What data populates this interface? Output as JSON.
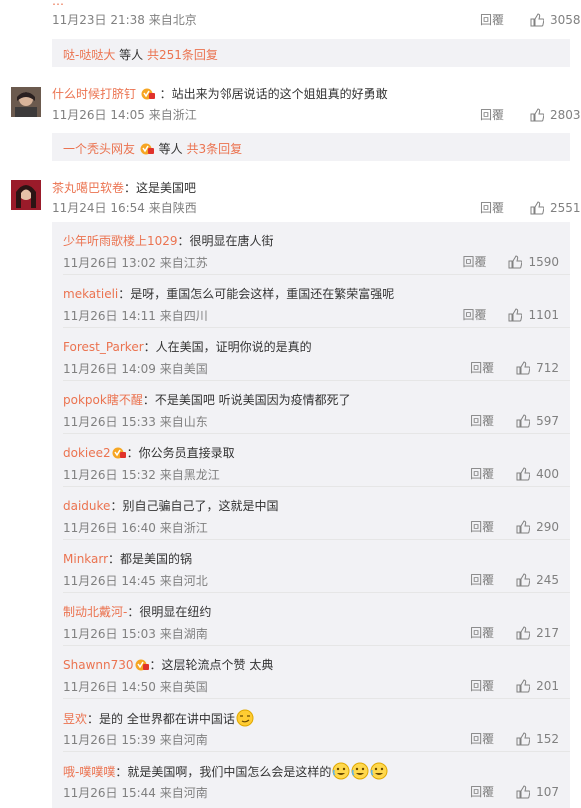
{
  "top": {
    "partial_text": "…",
    "meta": "11月23日 21:38 来自北京",
    "reply": "回覆",
    "likes": "3058",
    "sub_users": "哒-哒哒大",
    "sub_mid": " 等人",
    "sub_count": " 共251条回复"
  },
  "c1": {
    "user": "什么时候打脐钉",
    "text": "：站出来为邻居说话的这个姐姐真的好勇敢",
    "meta": "11月26日 14:05 来自浙江",
    "reply": "回覆",
    "likes": "2803",
    "sub_users": "一个秃头网友",
    "sub_mid": "等人",
    "sub_count": " 共3条回复"
  },
  "c2": {
    "user": "茶丸噶巴软卷",
    "text": "：这是美国吧",
    "meta": "11月24日 16:54 来自陕西",
    "reply": "回覆",
    "likes": "2551"
  },
  "replies": [
    {
      "user": "少年听雨歌楼上1029",
      "text": "：很明显在唐人街",
      "meta": "11月26日 13:02 来自江苏",
      "reply": "回覆",
      "likes": "1590"
    },
    {
      "user": "mekatieli",
      "text": "：是呀，重国怎么可能会这样，重国还在繁荣富强呢",
      "meta": "11月26日 14:11 来自四川",
      "reply": "回覆",
      "likes": "1101"
    },
    {
      "user": "Forest_Parker",
      "text": "：人在美国，证明你说的是真的",
      "meta": "11月26日 14:09 来自美国",
      "reply": "回覆",
      "likes": "712"
    },
    {
      "user": "pokpok瞎不醒",
      "text": "：不是美国吧 听说美国因为疫情都死了",
      "meta": "11月26日 15:33 来自山东",
      "reply": "回覆",
      "likes": "597"
    },
    {
      "user": "dokiee2",
      "text": "：你公务员直接录取",
      "meta": "11月26日 15:32 来自黑龙江",
      "reply": "回覆",
      "likes": "400"
    },
    {
      "user": "daiduke",
      "text": "：别自己骗自己了，这就是中国",
      "meta": "11月26日 16:40 来自浙江",
      "reply": "回覆",
      "likes": "290"
    },
    {
      "user": "Minkarr",
      "text": "：都是美国的锅",
      "meta": "11月26日 14:45 来自河北",
      "reply": "回覆",
      "likes": "245"
    },
    {
      "user": "制动北戴河-",
      "text": "：很明显在纽约",
      "meta": "11月26日 15:03 来自湖南",
      "reply": "回覆",
      "likes": "217"
    },
    {
      "user": "Shawnn730",
      "text": "：这层轮流点个赞 太典",
      "meta": "11月26日 14:50 来自英国",
      "reply": "回覆",
      "likes": "201"
    },
    {
      "user": "昱欢",
      "text": "：是的 全世界都在讲中国话",
      "meta": "11月26日 15:39 来自河南",
      "reply": "回覆",
      "likes": "152"
    },
    {
      "user": "哦-噗噗噗",
      "text": "：就是美国啊，我们中国怎么会是这样的",
      "meta": "11月26日 15:44 来自河南",
      "reply": "回覆",
      "likes": "107"
    }
  ],
  "colors": {
    "accent": "#eb7350",
    "meta": "#808080",
    "panel": "#f2f2f5"
  },
  "icons": {
    "like": "thumbs-up-icon",
    "badge": "vip-badge-icon",
    "emoji": "laugh-cry-emoji"
  }
}
